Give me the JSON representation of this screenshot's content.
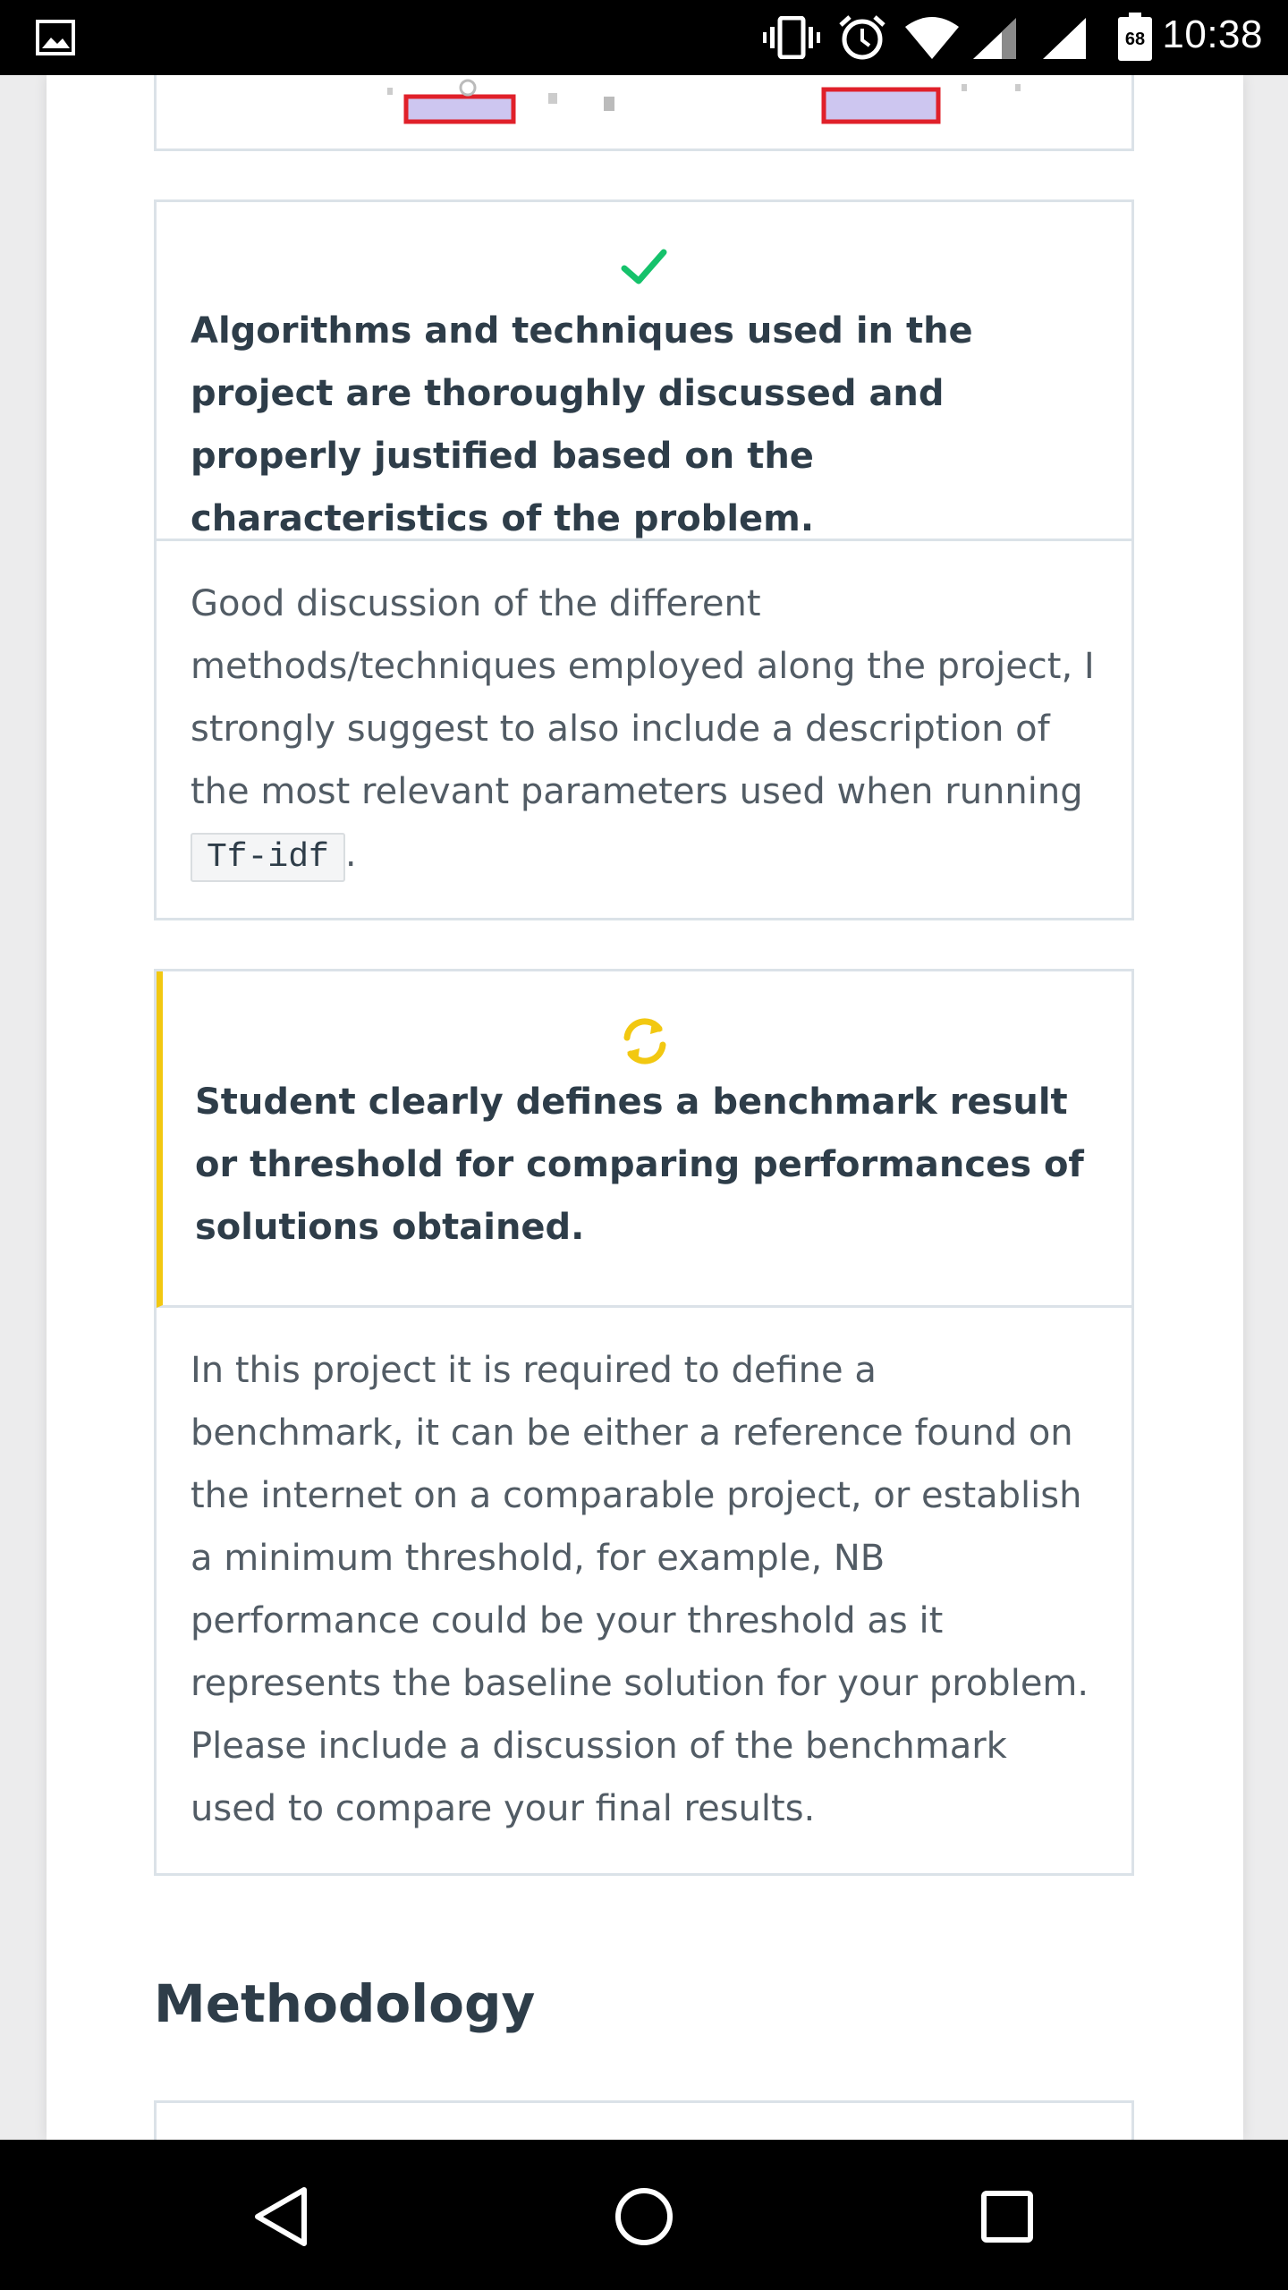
{
  "status_bar": {
    "time": "10:38",
    "battery_level": "68",
    "icons": [
      "gallery-icon",
      "vibrate-icon",
      "alarm-icon",
      "wifi-icon",
      "cell-signal-icon",
      "cell-signal-icon",
      "battery-icon"
    ]
  },
  "criteria": [
    {
      "status": "meets",
      "status_icon": "checkmark-icon",
      "status_color": "#02b3e4",
      "title": "Algorithms and techniques used in the project are thoroughly discussed and properly justified based on the characteristics of the problem.",
      "comment_before_code": "Good discussion of the different methods/techniques employed along the project, I strongly suggest to also include a description of the most relevant parameters used when running ",
      "comment_code": "Tf-idf",
      "comment_after_code": "."
    },
    {
      "status": "requires-changes",
      "status_icon": "refresh-icon",
      "status_color": "#f2c811",
      "title": "Student clearly defines a benchmark result or threshold for comparing performances of solutions obtained.",
      "comment": "In this project it is required to define a benchmark, it can be either a reference found on the internet on a comparable project, or establish a minimum threshold, for example, NB performance could be your threshold as it represents the baseline solution for your problem. Please include a discussion of the benchmark used to compare your final results."
    }
  ],
  "section": {
    "title": "Methodology"
  },
  "colors": {
    "pass_green": "#15c26b",
    "warn_yellow": "#f2c811",
    "text_dark": "#2e3d49",
    "text_body": "#525c65",
    "border": "#dbe2e8"
  },
  "nav_bar": {
    "buttons": [
      "back-icon",
      "home-icon",
      "recents-icon"
    ]
  }
}
